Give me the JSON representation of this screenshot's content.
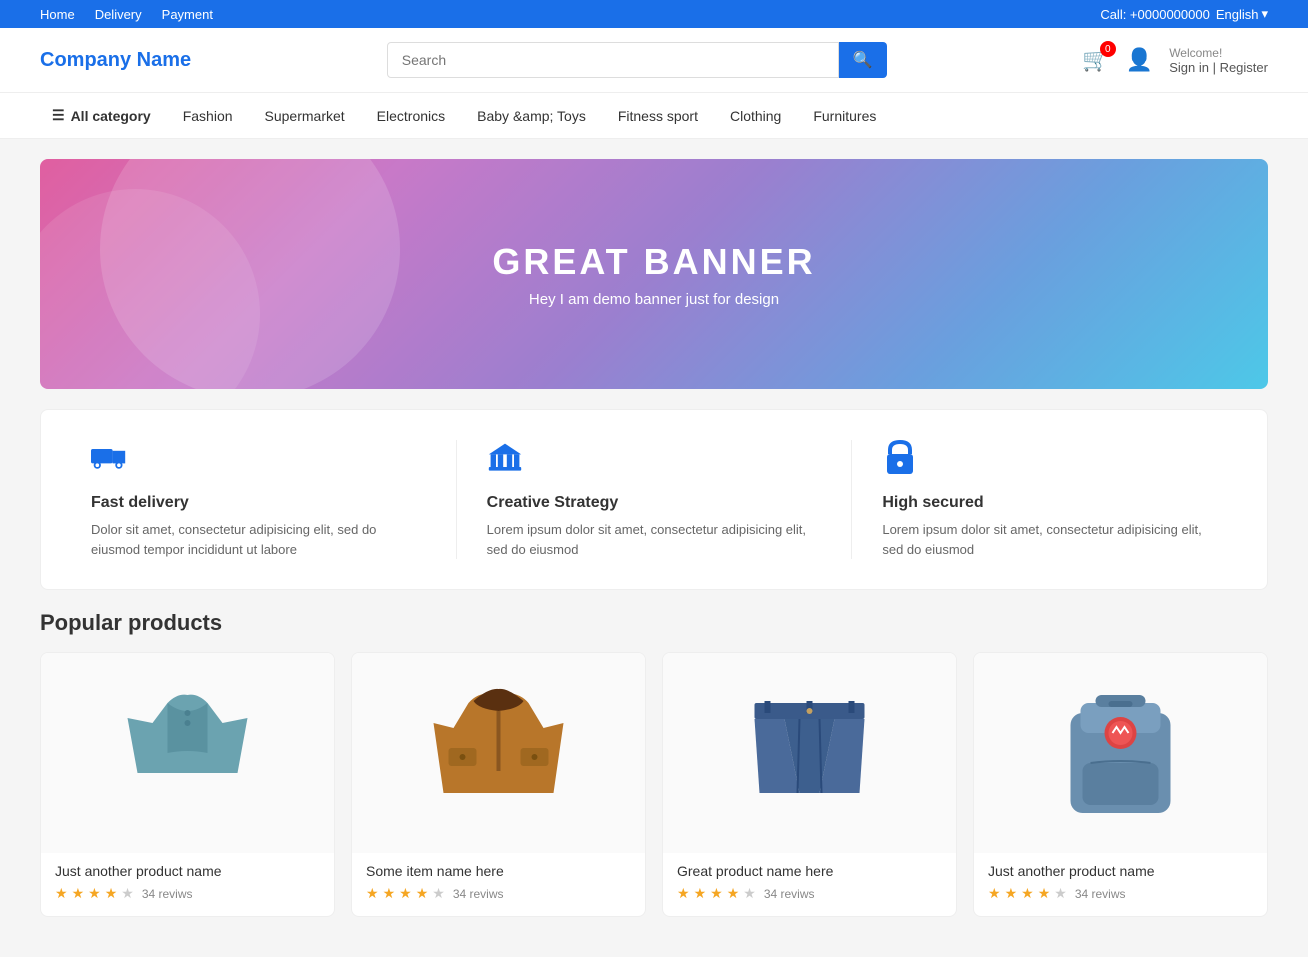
{
  "topbar": {
    "nav": [
      "Home",
      "Delivery",
      "Payment"
    ],
    "phone_label": "Call: +0000000000",
    "language": "English"
  },
  "header": {
    "logo": "Company Name",
    "search_placeholder": "Search",
    "cart_count": "0",
    "welcome_text": "Welcome!",
    "signin_label": "Sign in",
    "register_label": "Register"
  },
  "nav": {
    "all_category": "All category",
    "items": [
      "Fashion",
      "Supermarket",
      "Electronics",
      "Baby &amp; Toys",
      "Fitness sport",
      "Clothing",
      "Furnitures"
    ]
  },
  "banner": {
    "title": "GREAT BANNER",
    "subtitle": "Hey I am demo banner just for design"
  },
  "features": [
    {
      "id": "fast-delivery",
      "title": "Fast delivery",
      "desc": "Dolor sit amet, consectetur adipisicing elit, sed do eiusmod tempor incididunt ut labore"
    },
    {
      "id": "creative-strategy",
      "title": "Creative Strategy",
      "desc": "Lorem ipsum dolor sit amet, consectetur adipisicing elit, sed do eiusmod"
    },
    {
      "id": "high-secured",
      "title": "High secured",
      "desc": "Lorem ipsum dolor sit amet, consectetur adipisicing elit, sed do eiusmod"
    }
  ],
  "popular_section": {
    "title": "Popular products"
  },
  "products": [
    {
      "name": "Just another product name",
      "stars": 4,
      "reviews": "34 reviws",
      "color": "#6ba3b0"
    },
    {
      "name": "Some item name here",
      "stars": 4,
      "reviews": "34 reviws",
      "color": "#b8762a"
    },
    {
      "name": "Great product name here",
      "stars": 4,
      "reviews": "34 reviws",
      "color": "#4a6fa5"
    },
    {
      "name": "Just another product name",
      "stars": 4,
      "reviews": "34 reviws",
      "color": "#6a8faf"
    }
  ]
}
